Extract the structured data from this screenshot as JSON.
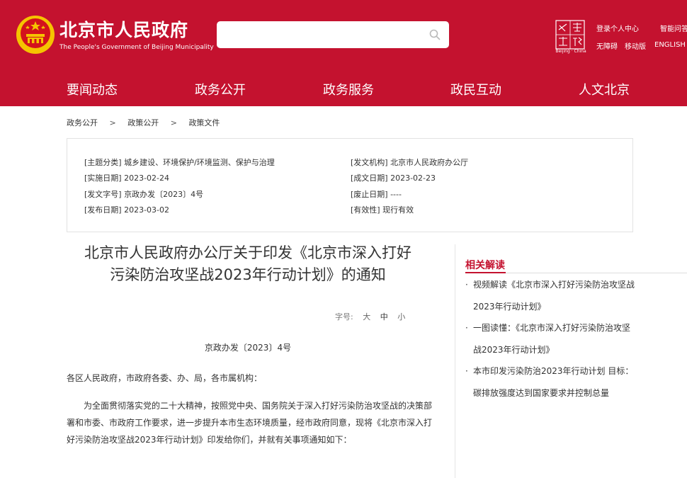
{
  "header": {
    "title": "北京市人民政府",
    "subtitle": "The People's Government of Beijing Municipality",
    "search": {
      "value": "",
      "placeholder": ""
    },
    "capital_logo": {
      "text_top": "之首",
      "text_bottom": "窗都",
      "caption": "Beijing · China"
    },
    "top_links": {
      "login": "登录个人中心",
      "smart_qa": "智能问答",
      "accessibility": "无障碍",
      "mobile": "移动版",
      "english": "ENGLISH"
    }
  },
  "nav": {
    "items": [
      "要闻动态",
      "政务公开",
      "政务服务",
      "政民互动",
      "人文北京"
    ]
  },
  "breadcrumb": [
    "政务公开",
    "政策公开",
    "政策文件"
  ],
  "breadcrumb_separator": ">",
  "meta": {
    "topic": "[主题分类] 城乡建设、环境保护/环境监测、保护与治理",
    "issuer": "[发文机构] 北京市人民政府办公厅",
    "effective_date": "[实施日期] 2023-02-24",
    "created_date": "[成文日期] 2023-02-23",
    "doc_number": "[发文字号] 京政办发〔2023〕4号",
    "abolish_date": "[废止日期] ----",
    "publish_date": "[发布日期] 2023-03-02",
    "validity": "[有效性] 现行有效"
  },
  "article": {
    "title_line1": "北京市人民政府办公厅关于印发《北京市深入打好",
    "title_line2": "污染防治攻坚战2023年行动计划》的通知",
    "font_size_label": "字号:",
    "font_sizes": [
      "大",
      "中",
      "小"
    ],
    "doc_number": "京政办发〔2023〕4号",
    "salutation": "各区人民政府，市政府各委、办、局，各市属机构：",
    "paragraph": "为全面贯彻落实党的二十大精神，按照党中央、国务院关于深入打好污染防治攻坚战的决策部署和市委、市政府工作要求，进一步提升本市生态环境质量，经市政府同意，现将《北京市深入打好污染防治攻坚战2023年行动计划》印发给你们，并就有关事项通知如下："
  },
  "related": {
    "heading": "相关解读",
    "bullet": "·",
    "items": [
      "视频解读《北京市深入打好污染防治攻坚战2023年行动计划》",
      "一图读懂：《北京市深入打好污染防治攻坚战2023年行动计划》",
      "本市印发污染防治2023年行动计划 目标：碳排放强度达到国家要求并控制总量"
    ]
  },
  "colors": {
    "brand_red": "#c4122f",
    "emblem_gold": "#f5c400"
  }
}
